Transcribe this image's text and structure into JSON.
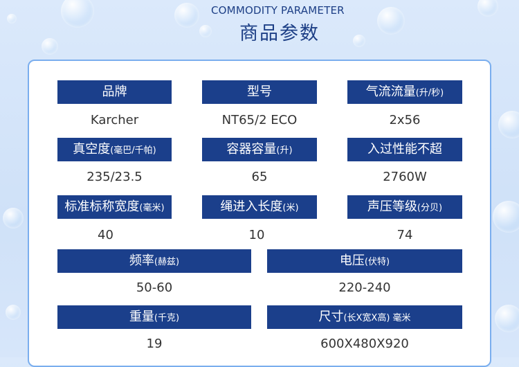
{
  "header": {
    "title_en": "COMMODITY PARAMETER",
    "title_cn": "商品参数"
  },
  "params": {
    "brand": {
      "label": "品牌",
      "value": "Karcher"
    },
    "model": {
      "label": "型号",
      "value": "NT65/2 ECO"
    },
    "airflow": {
      "label": "气流流量",
      "unit": "(升/秒)",
      "value": "2x56"
    },
    "vacuum": {
      "label": "真空度",
      "unit": "(毫巴/千帕)",
      "value": "235/23.5"
    },
    "capacity": {
      "label": "容器容量",
      "unit": "(升)",
      "value": "65"
    },
    "power": {
      "label": "入过性能不超",
      "value": "2760W"
    },
    "width": {
      "label": "标准标称宽度",
      "unit": "(毫米)",
      "value": "40"
    },
    "cord": {
      "label": "绳进入长度",
      "unit": "(米)",
      "value": "10"
    },
    "noise": {
      "label": "声压等级",
      "unit": "(分贝)",
      "value": "74"
    },
    "frequency": {
      "label": "频率",
      "unit": "(赫兹)",
      "value": "50-60"
    },
    "voltage": {
      "label": "电压",
      "unit": "(伏特)",
      "value": "220-240"
    },
    "weight": {
      "label": "重量",
      "unit": "(千克)",
      "value": "19"
    },
    "size": {
      "label": "尺寸",
      "unit": "(长X宽X高) 毫米",
      "value": "600X480X920"
    }
  }
}
